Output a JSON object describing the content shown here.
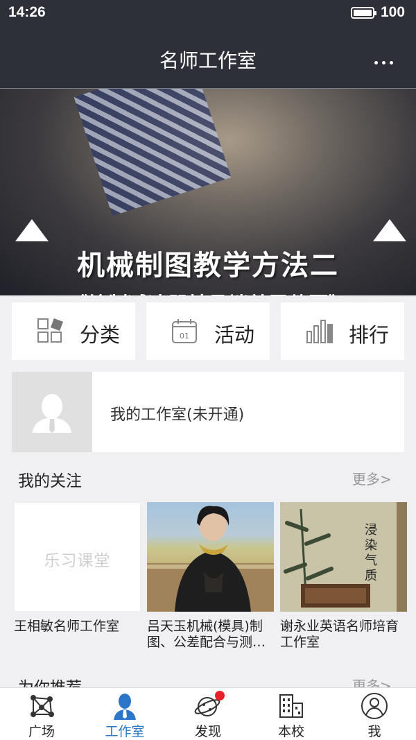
{
  "status_bar": {
    "time": "14:26",
    "battery": "100"
  },
  "header": {
    "title": "名师工作室"
  },
  "banner": {
    "headline": "机械制图教学方法二",
    "subline": "《绘制减速器轴承端盖零件图》",
    "stars": "★★★",
    "carousel_total": 3,
    "carousel_active": 3
  },
  "quick_actions": [
    {
      "label": "分类",
      "icon": "grid-icon"
    },
    {
      "label": "活动",
      "icon": "calendar-icon"
    },
    {
      "label": "排行",
      "icon": "bar-chart-icon"
    }
  ],
  "my_studio": {
    "label": "我的工作室(未开通)"
  },
  "following": {
    "title": "我的关注",
    "more": "更多>",
    "cards": [
      {
        "name": "王相敏名师工作室",
        "thumb_text": "乐习课堂"
      },
      {
        "name": "吕天玉机械(模具)制图、公差配合与测…"
      },
      {
        "name": "谢永业英语名师培育工作室",
        "thumb_text": "浸染气质"
      }
    ]
  },
  "recommend": {
    "title": "为你推荐",
    "more": "更多>"
  },
  "tabbar": {
    "items": [
      {
        "label": "广场",
        "icon": "network-icon"
      },
      {
        "label": "工作室",
        "icon": "teacher-icon"
      },
      {
        "label": "发现",
        "icon": "planet-icon"
      },
      {
        "label": "本校",
        "icon": "building-icon"
      },
      {
        "label": "我",
        "icon": "user-icon"
      }
    ],
    "active_index": 1
  },
  "colors": {
    "header_bg": "#2d3039",
    "accent": "#2b76c8",
    "badge": "#e8202a"
  }
}
